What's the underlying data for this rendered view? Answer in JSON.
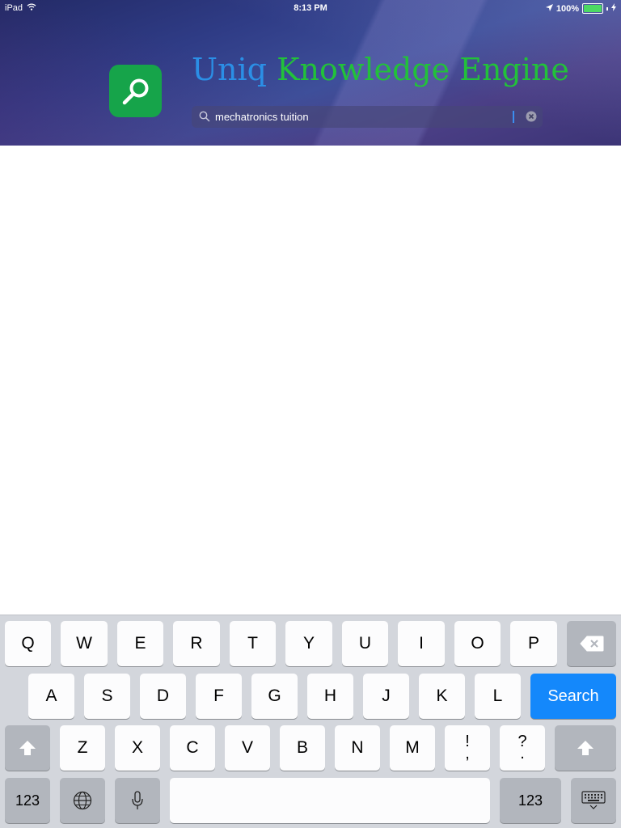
{
  "status_bar": {
    "device": "iPad",
    "time": "8:13 PM",
    "battery": "100%",
    "wifi_icon": "wifi-icon",
    "location_icon": "location-arrow-icon",
    "charging_icon": "charging-bolt-icon"
  },
  "header": {
    "brand_word_1": "Uniq",
    "brand_word_2": "Knowledge Engine",
    "colors": {
      "brand_word_1": "#2b8fe6",
      "brand_word_2": "#22c13a",
      "app_icon_bg": "#16a44a"
    }
  },
  "search": {
    "value": "mechatronics tuition",
    "icon": "magnifier-icon",
    "clear_icon": "clear-circle-icon"
  },
  "keyboard": {
    "row1": [
      "Q",
      "W",
      "E",
      "R",
      "T",
      "Y",
      "U",
      "I",
      "O",
      "P"
    ],
    "row2": [
      "A",
      "S",
      "D",
      "F",
      "G",
      "H",
      "J",
      "K",
      "L"
    ],
    "row3": [
      "Z",
      "X",
      "C",
      "V",
      "B",
      "N",
      "M"
    ],
    "punct1_top": "!",
    "punct1_bottom": ",",
    "punct2_top": "?",
    "punct2_bottom": ".",
    "search_label": "Search",
    "numbers_label": "123",
    "numbers_label_right": "123",
    "colors": {
      "search_key": "#1488fb"
    }
  }
}
